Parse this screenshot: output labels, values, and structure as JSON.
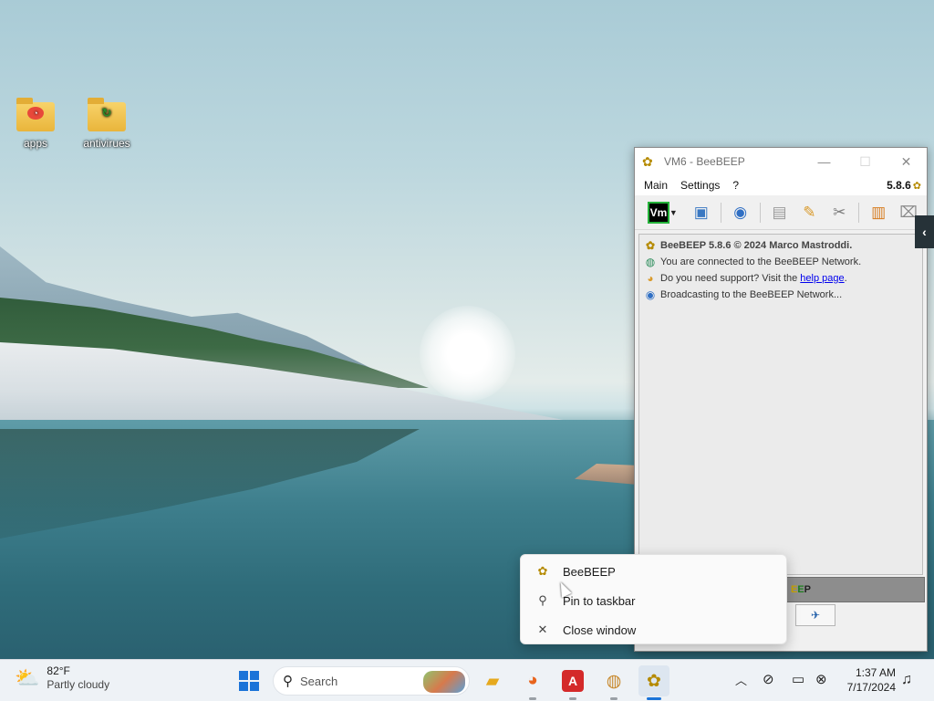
{
  "desktop": {
    "icons": [
      {
        "label": "apps"
      },
      {
        "label": "antivirues"
      }
    ]
  },
  "window": {
    "title": "VM6 - BeeBEEP",
    "menu": [
      "Main",
      "Settings",
      "?"
    ],
    "version": "5.8.6",
    "toolbar": {
      "vm_label": "Vm"
    },
    "chat": {
      "line1": "BeeBEEP 5.8.6 © 2024 Marco Mastroddi.",
      "line2": "You are connected to the BeeBEEP Network.",
      "line3_prefix": "Do you need support? Visit the ",
      "line3_link": "help page",
      "line3_suffix": ".",
      "line4": "Broadcasting to the BeeBEEP Network..."
    },
    "status_strip": {
      "part1": "E",
      "part2": "E",
      "part3": "P"
    }
  },
  "jumplist": {
    "items": [
      {
        "label": "BeeBEEP",
        "icon": "beebeep-icon"
      },
      {
        "label": "Pin to taskbar",
        "icon": "pin-icon"
      },
      {
        "label": "Close window",
        "icon": "close-icon"
      }
    ]
  },
  "taskbar": {
    "weather_temp": "82°F",
    "weather_condition": "Partly cloudy",
    "search_placeholder": "Search",
    "time": "1:37 AM",
    "date": "7/17/2024"
  }
}
